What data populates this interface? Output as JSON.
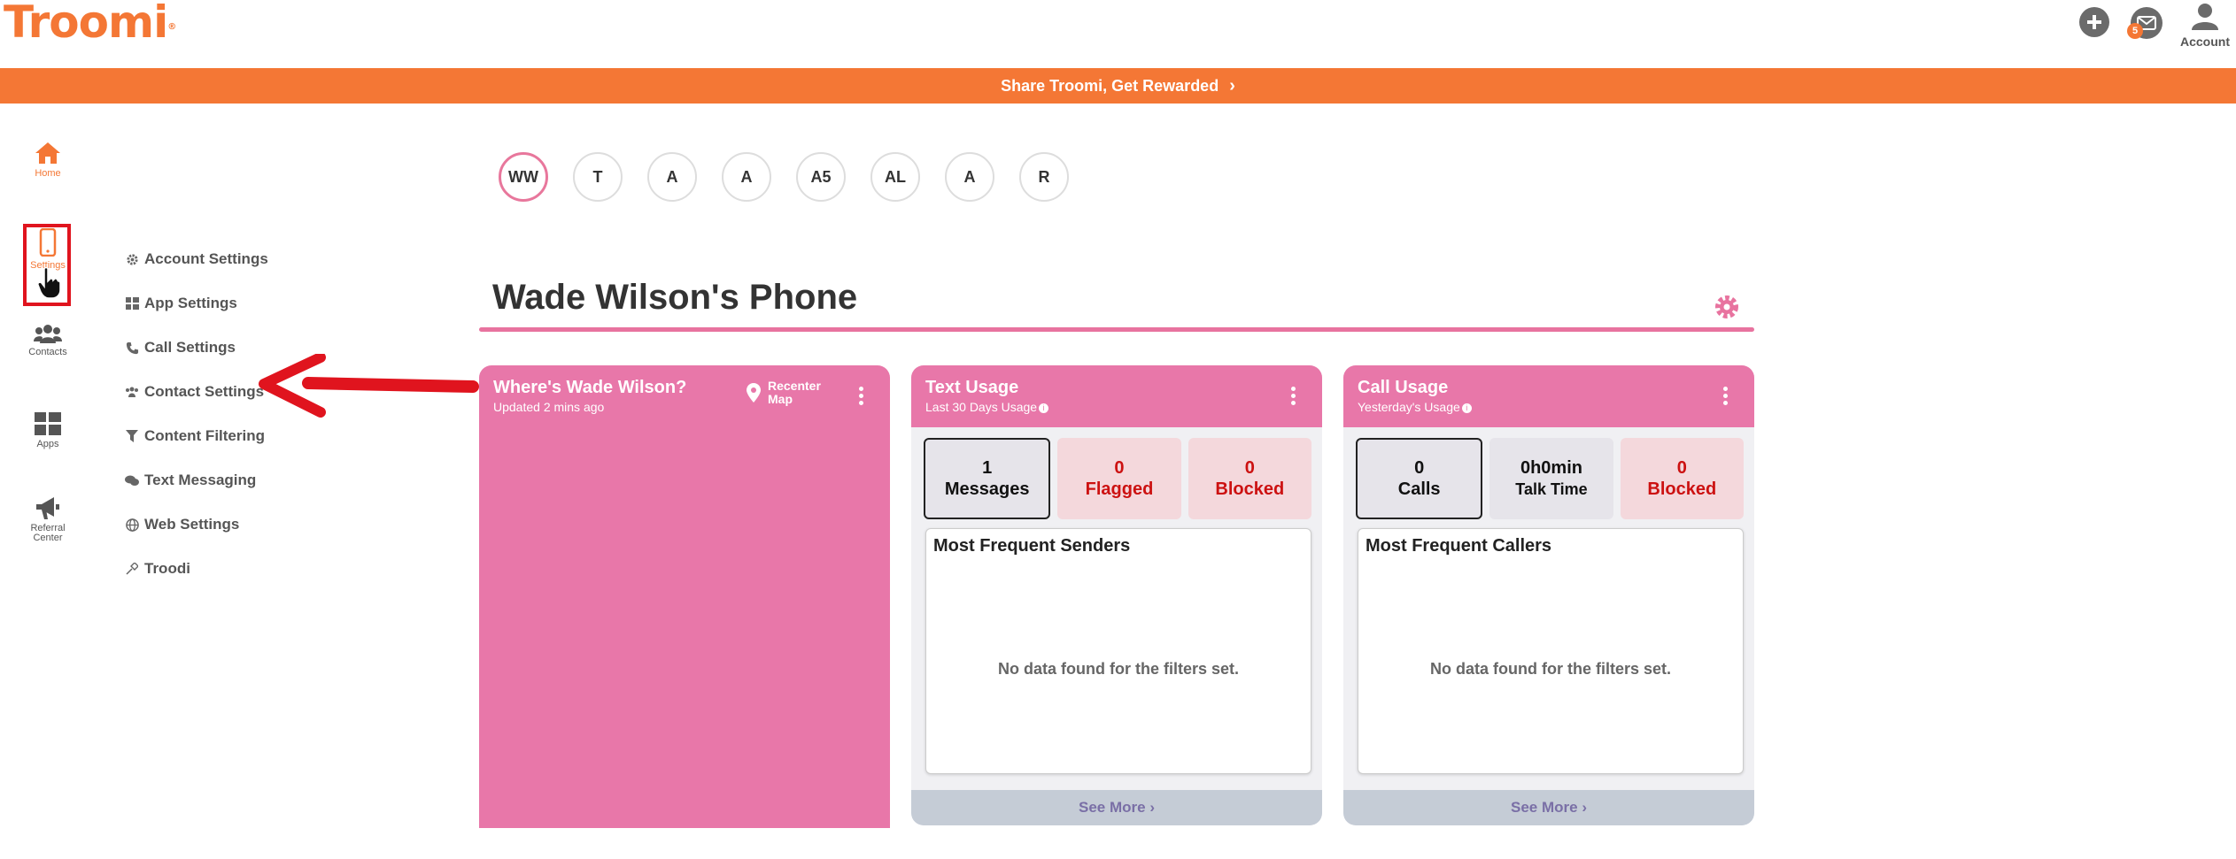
{
  "brand": {
    "name": "Troomi",
    "accent": "#f47735",
    "pink": "#e877a9"
  },
  "header": {
    "mail_badge": "5",
    "account_label": "Account"
  },
  "banner": {
    "text": "Share Troomi, Get Rewarded"
  },
  "rail": {
    "home": "Home",
    "settings": "Settings",
    "contacts": "Contacts",
    "apps": "Apps",
    "referral_line1": "Referral",
    "referral_line2": "Center"
  },
  "submenu": [
    {
      "label": "Account Settings",
      "icon": "gear-icon"
    },
    {
      "label": "App Settings",
      "icon": "grid-icon"
    },
    {
      "label": "Call Settings",
      "icon": "phone-icon"
    },
    {
      "label": "Contact Settings",
      "icon": "users-icon"
    },
    {
      "label": "Content Filtering",
      "icon": "filter-icon"
    },
    {
      "label": "Text Messaging",
      "icon": "chat-icon"
    },
    {
      "label": "Web Settings",
      "icon": "globe-icon"
    },
    {
      "label": "Troodi",
      "icon": "pin-icon"
    }
  ],
  "devices": [
    "WW",
    "T",
    "A",
    "A",
    "A5",
    "AL",
    "A",
    "R"
  ],
  "page_title": "Wade Wilson's Phone",
  "where_card": {
    "title": "Where's Wade Wilson?",
    "subtitle": "Updated 2 mins ago",
    "recenter_line1": "Recenter",
    "recenter_line2": "Map"
  },
  "text_card": {
    "title": "Text Usage",
    "subtitle": "Last 30 Days Usage",
    "stats": [
      {
        "value": "1",
        "label": "Messages"
      },
      {
        "value": "0",
        "label": "Flagged"
      },
      {
        "value": "0",
        "label": "Blocked"
      }
    ],
    "panel_title": "Most Frequent Senders",
    "empty": "No data found for the filters set.",
    "see_more": "See More"
  },
  "call_card": {
    "title": "Call Usage",
    "subtitle": "Yesterday's Usage",
    "stats": [
      {
        "value": "0",
        "label": "Calls"
      },
      {
        "value": "0h0min",
        "label": "Talk Time"
      },
      {
        "value": "0",
        "label": "Blocked"
      }
    ],
    "panel_title": "Most Frequent Callers",
    "empty": "No data found for the filters set.",
    "see_more": "See More"
  }
}
